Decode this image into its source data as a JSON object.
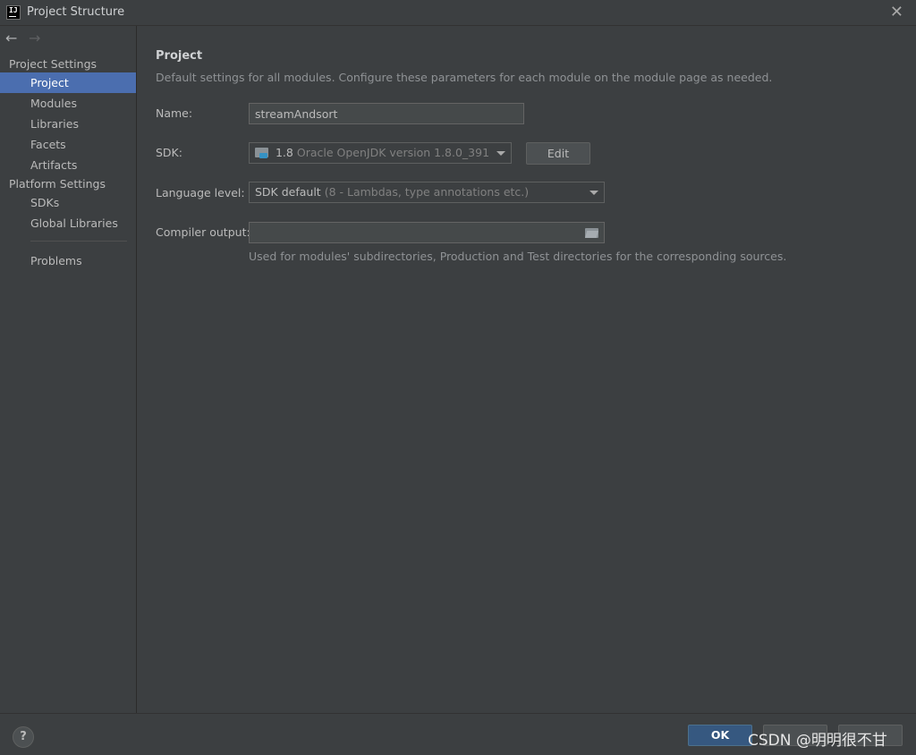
{
  "window": {
    "title": "Project Structure",
    "app_icon_text": "IJ"
  },
  "sidebar": {
    "project_settings_header": "Project Settings",
    "project_items": [
      {
        "label": "Project",
        "selected": true
      },
      {
        "label": "Modules"
      },
      {
        "label": "Libraries"
      },
      {
        "label": "Facets"
      },
      {
        "label": "Artifacts"
      }
    ],
    "platform_settings_header": "Platform Settings",
    "platform_items": [
      {
        "label": "SDKs"
      },
      {
        "label": "Global Libraries"
      }
    ],
    "problems_label": "Problems"
  },
  "main": {
    "title": "Project",
    "description": "Default settings for all modules. Configure these parameters for each module on the module page as needed.",
    "name_label": "Name:",
    "name_value": "streamAndsort",
    "sdk_label": "SDK:",
    "sdk_version": "1.8",
    "sdk_detail": "Oracle OpenJDK version 1.8.0_391",
    "edit_button": "Edit",
    "language_level_label": "Language level:",
    "language_level_value": "SDK default",
    "language_level_detail": "(8 - Lambdas, type annotations etc.)",
    "compiler_output_label": "Compiler output:",
    "compiler_output_value": "",
    "compiler_output_hint": "Used for modules' subdirectories, Production and Test directories for the corresponding sources."
  },
  "footer": {
    "help_label": "?",
    "ok_label": "OK",
    "watermark": "CSDN @明明很不甘"
  },
  "colors": {
    "background": "#3c3f41",
    "selection": "#4b6eaf",
    "primary_button": "#365880"
  }
}
